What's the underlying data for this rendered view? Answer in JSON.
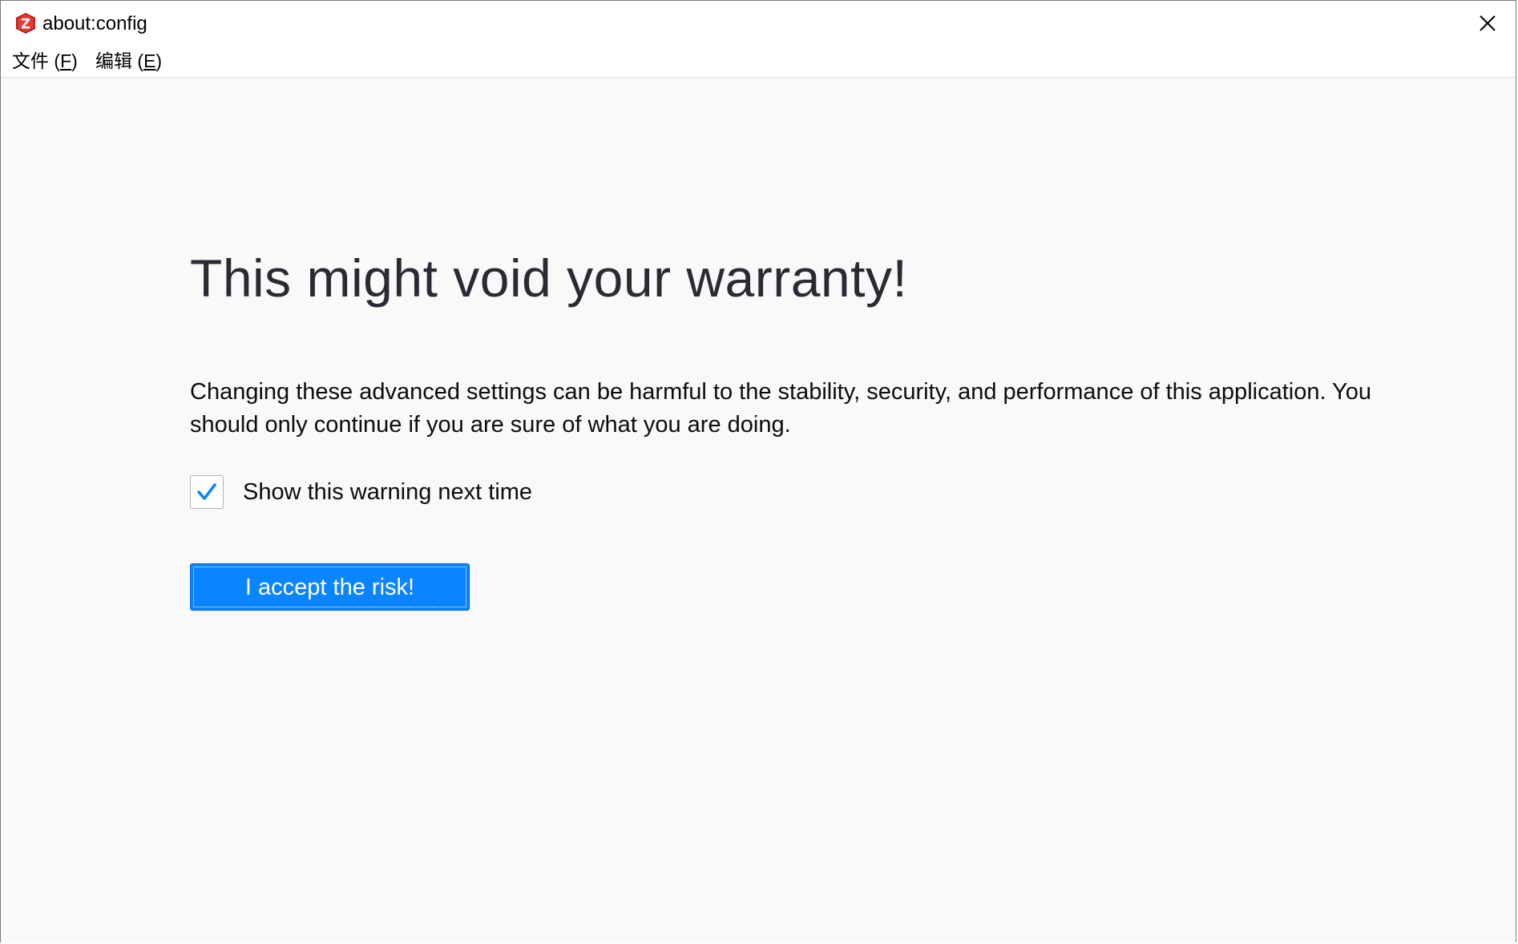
{
  "window": {
    "title": "about:config",
    "close_icon": "close-icon"
  },
  "menubar": {
    "file": {
      "label": "文件 (",
      "accel": "F",
      "suffix": ")"
    },
    "edit": {
      "label": "编辑 (",
      "accel": "E",
      "suffix": ")"
    }
  },
  "warning": {
    "heading": "This might void your warranty!",
    "description": "Changing these advanced settings can be harmful to the stability, security, and performance of this application. You should only continue if you are sure of what you are doing.",
    "checkbox_label": "Show this warning next time",
    "checkbox_checked": true,
    "accept_button": "I accept the risk!"
  },
  "colors": {
    "accent": "#0a84ff",
    "checkmark": "#0a84ff",
    "app_icon": "#d32f2f"
  }
}
